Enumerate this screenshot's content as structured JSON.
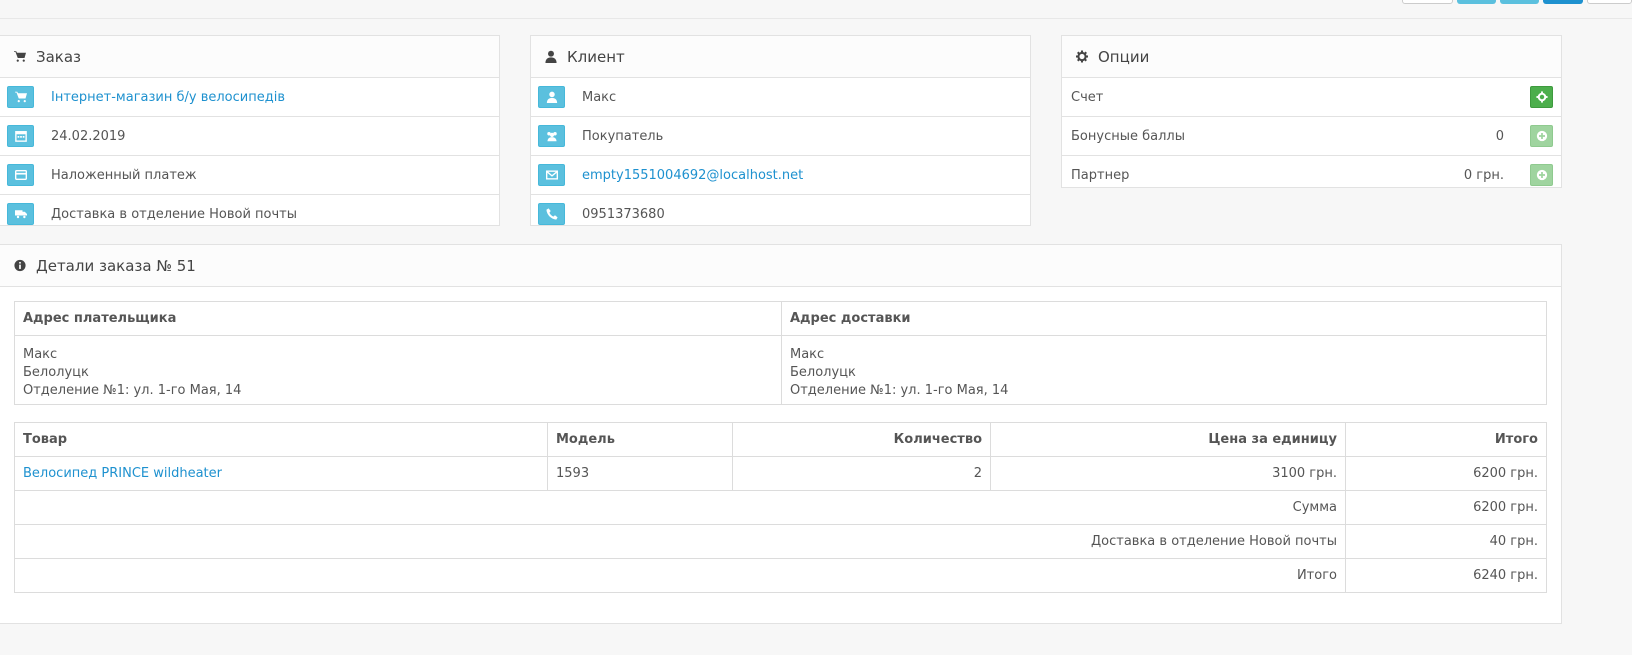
{
  "order": {
    "title": "Заказ",
    "store": "Інтернет-магазин б/у велосипедів",
    "date": "24.02.2019",
    "payment": "Наложенный платеж",
    "shipping": "Доставка в отделение Новой почты"
  },
  "customer": {
    "title": "Клиент",
    "name": "Макс",
    "group": "Покупатель",
    "email": "empty1551004692@localhost.net",
    "phone": "0951373680"
  },
  "options": {
    "title": "Опции",
    "invoice_label": "Счет",
    "bonus_label": "Бонусные баллы",
    "bonus_value": "0",
    "affiliate_label": "Партнер",
    "affiliate_value": "0 грн."
  },
  "details": {
    "title": "Детали заказа № 51",
    "payment_address_header": "Адрес плательщика",
    "shipping_address_header": "Адрес доставки",
    "payment_address": [
      "Макс",
      "Белолуцк",
      "Отделение №1: ул. 1-го Мая, 14"
    ],
    "shipping_address": [
      "Макс",
      "Белолуцк",
      "Отделение №1: ул. 1-го Мая, 14"
    ],
    "columns": [
      "Товар",
      "Модель",
      "Количество",
      "Цена за единицу",
      "Итого"
    ],
    "products": [
      {
        "name": "Велосипед PRINCE wildheater",
        "model": "1593",
        "quantity": "2",
        "price": "3100 грн.",
        "total": "6200 грн."
      }
    ],
    "totals": [
      {
        "label": "Сумма",
        "value": "6200 грн."
      },
      {
        "label": "Доставка в отделение Новой почты",
        "value": "40 грн."
      },
      {
        "label": "Итого",
        "value": "6240 грн."
      }
    ]
  },
  "colors": {
    "info": "#5bc0de",
    "success": "#4cae4c",
    "link": "#1e91cf"
  },
  "icons": {
    "order": "shopping-cart-icon",
    "customer": "user-icon",
    "options": "cog-icon",
    "details": "info-circle-icon"
  }
}
